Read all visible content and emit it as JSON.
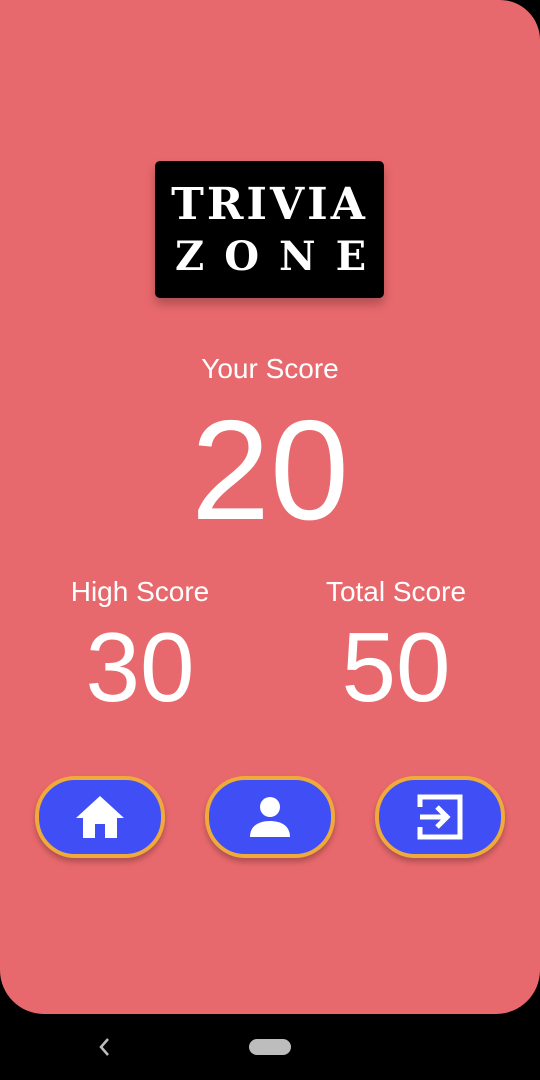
{
  "logo": {
    "line1": "TRIVIA",
    "line2": "ZONE"
  },
  "score": {
    "your_label": "Your Score",
    "your_value": "20",
    "high_label": "High Score",
    "high_value": "30",
    "total_label": "Total Score",
    "total_value": "50"
  },
  "buttons": [
    {
      "name": "home",
      "icon": "home-icon"
    },
    {
      "name": "profile",
      "icon": "person-icon"
    },
    {
      "name": "exit",
      "icon": "exit-icon"
    }
  ],
  "colors": {
    "background": "#e8696d",
    "button_fill": "#3f4ef5",
    "button_border": "#f0a93b",
    "logo_bg": "#000000",
    "text": "#ffffff"
  },
  "system_nav": {
    "back_icon": "back-chevron-icon",
    "home_icon": "home-pill-icon"
  }
}
